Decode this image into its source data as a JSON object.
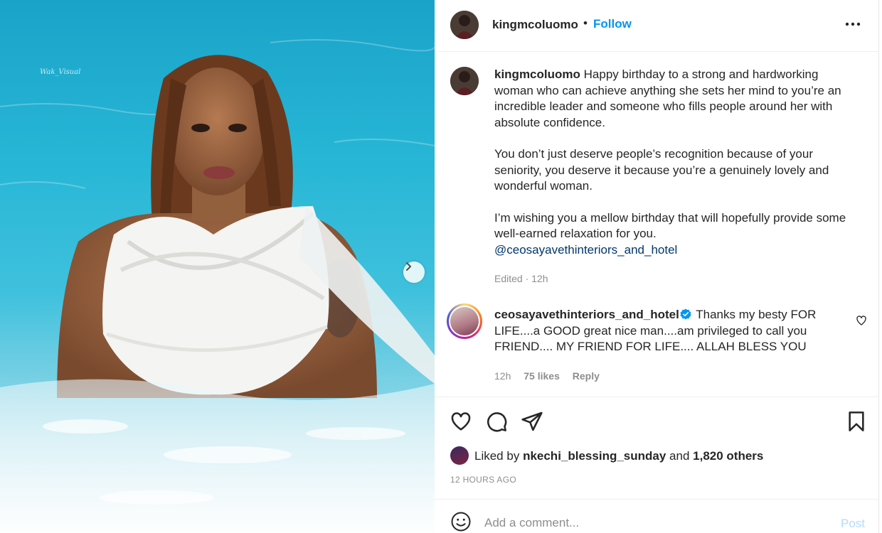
{
  "post": {
    "author": "kingmcoluomo",
    "follow_label": "Follow",
    "separator": "•",
    "more_icon": "more-horizontal-icon",
    "photo": {
      "watermark": "Wak_Visual",
      "next_icon": "chevron-right-icon"
    }
  },
  "caption": {
    "username": "kingmcoluomo",
    "paragraph1": "Happy birthday to a strong and hardworking woman who can achieve anything she sets her mind to you’re an incredible leader and someone who fills people around her with absolute confidence.",
    "paragraph2": "You don’t just deserve people’s recognition because of your seniority, you deserve it because you’re a genuinely lovely and wonderful woman.",
    "paragraph3": "I’m wishing you a mellow birthday that will hopefully provide some well-earned relaxation for you.",
    "mention": "@ceosayavethinteriors_and_hotel",
    "meta": "Edited · 12h"
  },
  "comment": {
    "username": "ceosayavethinteriors_and_hotel",
    "text": "Thanks my besty FOR LIFE....a GOOD great nice man....am privileged to call you FRIEND.... MY FRIEND FOR LIFE.... ALLAH BLESS YOU",
    "age": "12h",
    "likes": "75 likes",
    "reply_label": "Reply"
  },
  "actions": {
    "icons": [
      "heart-icon",
      "comment-icon",
      "share-icon",
      "bookmark-icon"
    ]
  },
  "likes": {
    "prefix": "Liked by",
    "user": "nkechi_blessing_sunday",
    "joiner": "and",
    "others": "1,820 others"
  },
  "timestamp": "12 HOURS AGO",
  "add_comment": {
    "placeholder": "Add a comment...",
    "post_label": "Post"
  },
  "colors": {
    "accent": "#0095f6",
    "post_disabled": "#b3dbff",
    "muted": "#8e8e8e",
    "mention": "#00376b"
  }
}
